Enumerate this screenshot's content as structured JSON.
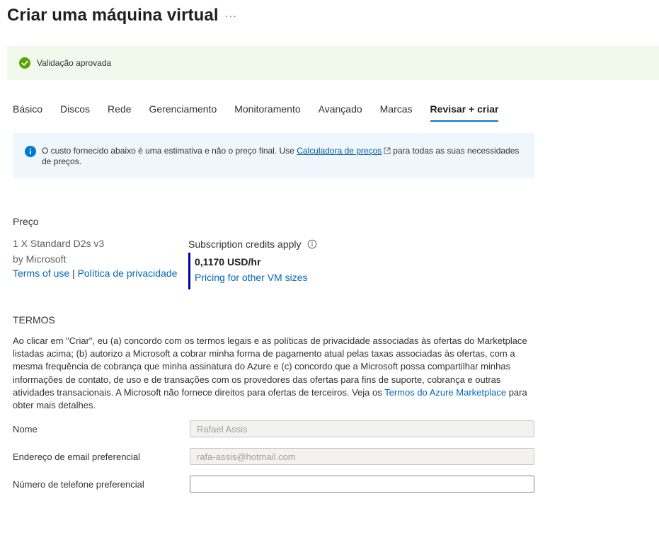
{
  "header": {
    "title": "Criar uma máquina virtual",
    "more_label": "···"
  },
  "validation": {
    "text": "Validação aprovada"
  },
  "tabs": [
    {
      "label": "Básico"
    },
    {
      "label": "Discos"
    },
    {
      "label": "Rede"
    },
    {
      "label": "Gerenciamento"
    },
    {
      "label": "Monitoramento"
    },
    {
      "label": "Avançado"
    },
    {
      "label": "Marcas"
    },
    {
      "label": "Revisar + criar",
      "active": true
    }
  ],
  "info": {
    "text_before": "O custo fornecido abaixo é uma estimativa e não o preço final. Use ",
    "link": "Calculadora de preços",
    "text_after": "para todas as suas necessidades de preços."
  },
  "price": {
    "heading": "Preço",
    "product": "1 X Standard D2s v3",
    "publisher": "by Microsoft",
    "terms_link": "Terms of use",
    "separator": " | ",
    "privacy_link": "Política de privacidade",
    "credits_label": "Subscription credits apply",
    "value": "0,1170 USD/hr",
    "other_sizes_link": "Pricing for other VM sizes"
  },
  "terms": {
    "heading": "TERMOS",
    "body_before": "Ao clicar em \"Criar\", eu (a) concordo com os termos legais e as políticas de privacidade associadas às ofertas do Marketplace listadas acima; (b) autorizo a Microsoft a cobrar minha forma de pagamento atual pelas taxas associadas às ofertas, com a mesma frequência de cobrança que minha assinatura do Azure e (c) concordo que a Microsoft possa compartilhar minhas informações de contato, de uso e de transações com os provedores das ofertas para fins de suporte, cobrança e outras atividades transacionais. A Microsoft não fornece direitos para ofertas de terceiros. Veja os ",
    "link": "Termos do Azure Marketplace",
    "body_after": " para obter mais detalhes."
  },
  "form": {
    "name_label": "Nome",
    "name_value": "Rafael Assis",
    "email_label": "Endereço de email preferencial",
    "email_value": "rafa-assis@hotmail.com",
    "phone_label": "Número de telefone preferencial",
    "phone_value": ""
  },
  "colors": {
    "accent": "#0078d4",
    "success": "#57a300",
    "link": "#0067b8",
    "price_bar": "#0000aa"
  }
}
